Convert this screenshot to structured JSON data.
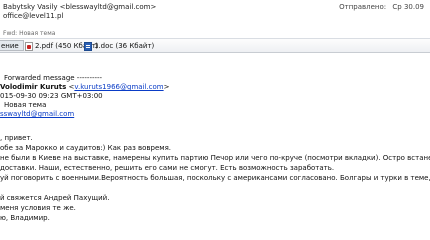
{
  "header": {
    "from": "Babytsky Vasily <blesswayltd@gmail.com>",
    "to": "office@level11.pl",
    "sent_label": "Отправлено:",
    "sent_value": "Ср 30.09"
  },
  "subject_line": "Fwd: Новая тема",
  "attachments": {
    "message_tab": "ение",
    "items": [
      {
        "name": "2.pdf (450 Кбайт)",
        "icon": "pdf-icon"
      },
      {
        "name": "1.doc (36 Кбайт)",
        "icon": "word-doc-icon"
      }
    ]
  },
  "forwarded": {
    "marker": "Forwarded message ----------",
    "from_name": "Volodimir Kuruts",
    "from_email_open": " <",
    "from_email": "v.kuruts1966@gmail.com",
    "from_email_close": ">",
    "date": "015-09-30 09:23 GMT+03:00",
    "subject": "Новая тема",
    "to_email": "sswayltd@gmail.com"
  },
  "message": {
    "greeting": ", привет.",
    "line1": "обе за Марокко и саудитов:) Как раз вовремя.",
    "line2": "не были в Киеве на выставке, намерены купить партию Печор или чего по-круче (посмотри вкладки). Остро встанет",
    "line3": "доставки. Наши, естественно, решить его сами не смогут. Есть возможность заработать.",
    "line4": "уй поговорить с военными.Вероятность большая, поскольку с американсами согласовано. Болгары и турки в теме, ско",
    "line5": "й свяжется Андрей Пахущий.",
    "line6": "меня условия те же.",
    "line7": "ю, Владимир."
  }
}
